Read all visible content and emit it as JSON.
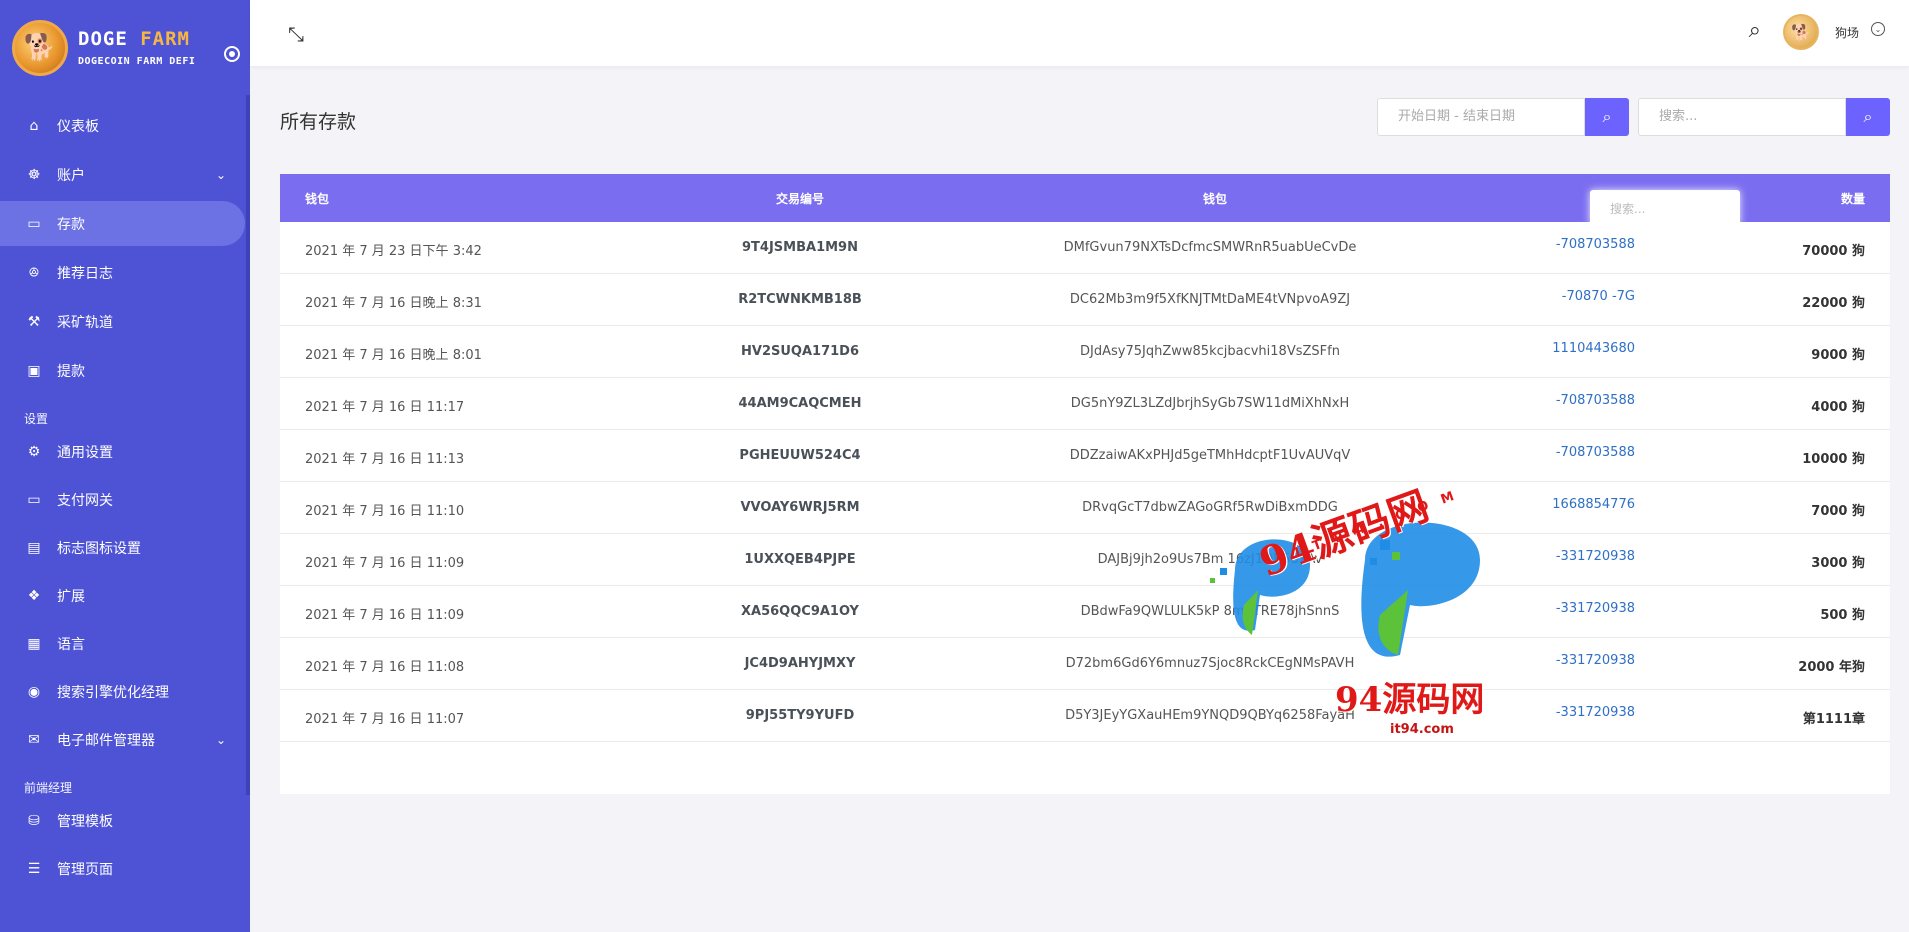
{
  "brand": {
    "name_part1": "DOGE",
    "name_part2": "FARM",
    "subtitle": "DOGECOIN FARM DEFI"
  },
  "sidebar": {
    "items": [
      {
        "label": "仪表板",
        "icon": "home-icon"
      },
      {
        "label": "账户",
        "icon": "users-cog-icon"
      },
      {
        "label": "存款",
        "icon": "wallet-icon"
      },
      {
        "label": "推荐日志",
        "icon": "users-icon"
      },
      {
        "label": "采矿轨道",
        "icon": "hammer-icon"
      },
      {
        "label": "提款",
        "icon": "money-icon"
      }
    ],
    "section_settings": "设置",
    "settings_items": [
      {
        "label": "通用设置",
        "icon": "settings-icon"
      },
      {
        "label": "支付网关",
        "icon": "credit-card-icon"
      },
      {
        "label": "标志图标设置",
        "icon": "image-icon"
      },
      {
        "label": "扩展",
        "icon": "puzzle-icon"
      },
      {
        "label": "语言",
        "icon": "language-icon"
      },
      {
        "label": "搜索引擎优化经理",
        "icon": "globe-icon"
      },
      {
        "label": "电子邮件管理器",
        "icon": "mail-icon"
      }
    ],
    "section_frontend": "前端经理",
    "frontend_items": [
      {
        "label": "管理模板",
        "icon": "template-icon"
      },
      {
        "label": "管理页面",
        "icon": "list-icon"
      }
    ]
  },
  "topbar": {
    "user_name": "狗场"
  },
  "page": {
    "title": "所有存款",
    "date_placeholder": "开始日期 - 结束日期",
    "search_placeholder": "搜索..."
  },
  "table": {
    "headers": {
      "wallet": "钱包",
      "txid": "交易编号",
      "wallet2": "钱包",
      "amount": "数量"
    },
    "inline_search_placeholder": "搜索...",
    "rows": [
      {
        "date": "2021 年 7 月 23 日下午 3:42",
        "tx": "9T4JSMBA1M9N",
        "addr": "DMfGvun79NXTsDcfmcSMWRnR5uabUeCvDe",
        "user": "-708703588",
        "amount": "70000 狗"
      },
      {
        "date": "2021 年 7 月 16 日晚上 8:31",
        "tx": "R2TCWNKMB18B",
        "addr": "DC62Mb3m9f5XfKNJTMtDaME4tVNpvoA9ZJ",
        "user": "-70870   -7G",
        "amount": "22000 狗"
      },
      {
        "date": "2021 年 7 月 16 日晚上 8:01",
        "tx": "HV2SUQA171D6",
        "addr": "DJdAsy75JqhZww85kcjbacvhi18VsZSFfn",
        "user": "1110443680",
        "amount": "9000 狗"
      },
      {
        "date": "2021 年 7 月 16 日 11:17",
        "tx": "44AM9CAQCMEH",
        "addr": "DG5nY9ZL3LZdJbrjhSyGb7SW11dMiXhNxH",
        "user": "-708703588",
        "amount": "4000 狗"
      },
      {
        "date": "2021 年 7 月 16 日 11:13",
        "tx": "PGHEUUW524C4",
        "addr": "DDZzaiwAKxPHJd5geTMhHdcptF1UvAUVqV",
        "user": "-708703588",
        "amount": "10000 狗"
      },
      {
        "date": "2021 年 7 月 16 日 11:10",
        "tx": "VVOAY6WRJ5RM",
        "addr": "DRvqGcT7dbwZAGoGRf5RwDiBxmDDG",
        "user": "1668854776",
        "amount": "7000 狗"
      },
      {
        "date": "2021 年 7 月 16 日 11:09",
        "tx": "1UXXQEB4PJPE",
        "addr": "DAJBj9jh2o9Us7Bm   16zJ1QR58xAv",
        "user": "-331720938",
        "amount": "3000 狗"
      },
      {
        "date": "2021 年 7 月 16 日 11:09",
        "tx": "XA56QQC9A1OY",
        "addr": "DBdwFa9QWLULK5kP   8mqTRE78jhSnnS",
        "user": "-331720938",
        "amount": "500 狗"
      },
      {
        "date": "2021 年 7 月 16 日 11:08",
        "tx": "JC4D9AHYJMXY",
        "addr": "D72bm6Gd6Y6mnuz7Sjoc8RckCEgNMsPAVH",
        "user": "-331720938",
        "amount": "2000 年狗"
      },
      {
        "date": "2021 年 7 月 16 日 11:07",
        "tx": "9PJ55TY9YUFD",
        "addr": "D5Y3JEyYGXauHEm9YNQD9QBYq6258FayaH",
        "user": "-331720938",
        "amount": "第1111章"
      }
    ]
  },
  "watermark": {
    "top_text": "94源码网",
    "com_text": "IT94.COM",
    "bottom_text": "94源码网",
    "url_text": "it94.com"
  },
  "colors": {
    "sidebar_bg": "#4e53d6",
    "accent": "#6c63ff",
    "table_head": "#7b6df0",
    "link": "#2f6fc6"
  }
}
